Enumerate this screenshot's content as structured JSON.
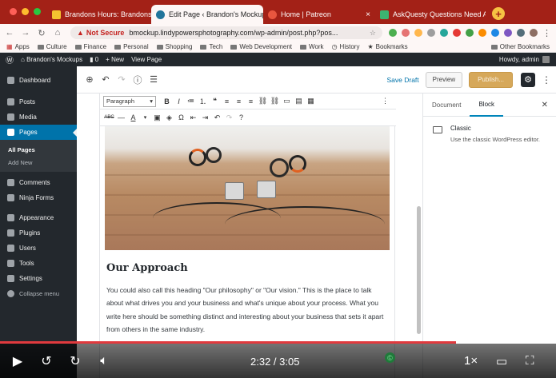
{
  "browser": {
    "tabs": [
      {
        "title": "Brandons Hours: Brandons Ho",
        "active": false,
        "favicon_color": "#f4c430"
      },
      {
        "title": "Edit Page ‹ Brandon's Mockup",
        "active": true,
        "favicon_color": "#21759b"
      },
      {
        "title": "Home | Patreon",
        "active": false,
        "favicon_color": "#e8563f"
      },
      {
        "title": "AskQuesty Questions Need A",
        "active": false,
        "favicon_color": "#3cb371"
      }
    ],
    "not_secure": "Not Secure",
    "url": "bmockup.lindypowersphotography.com/wp-admin/post.php?pos...",
    "bookmarks": [
      "Apps",
      "Culture",
      "Finance",
      "Personal",
      "Shopping",
      "Tech",
      "Web Development",
      "Work",
      "History",
      "Bookmarks"
    ],
    "other_bookmarks": "Other Bookmarks"
  },
  "adminbar": {
    "site_name": "Brandon's Mockups",
    "comments_count": "0",
    "new_label": "New",
    "view_page": "View Page",
    "howdy": "Howdy, admin"
  },
  "sidebar": {
    "items": [
      {
        "label": "Dashboard"
      },
      {
        "label": "Posts"
      },
      {
        "label": "Media"
      },
      {
        "label": "Pages"
      },
      {
        "label": "Comments"
      },
      {
        "label": "Ninja Forms"
      },
      {
        "label": "Appearance"
      },
      {
        "label": "Plugins"
      },
      {
        "label": "Users"
      },
      {
        "label": "Tools"
      },
      {
        "label": "Settings"
      },
      {
        "label": "Collapse menu"
      }
    ],
    "sub": {
      "all_pages": "All Pages",
      "add_new": "Add New"
    }
  },
  "editor": {
    "save_draft": "Save Draft",
    "preview": "Preview",
    "publish": "Publish...",
    "format_select": "Paragraph",
    "heading": "Our Approach",
    "paragraph": "You could also call this heading \"Our philosophy\" or \"Our vision.\" This is the place to talk about what drives you and your business and what's unique about your process. What you write here should be something distinct and interesting about your business that sets it apart from others in the same industry."
  },
  "panel": {
    "tab_document": "Document",
    "tab_block": "Block",
    "block_name": "Classic",
    "block_desc": "Use the classic WordPress editor."
  },
  "video": {
    "time": "2:32 / 3:05",
    "speed": "1×",
    "progress": 0.82
  },
  "colors": {
    "chrome_tabbar": "#a32117",
    "wp_dark": "#23282d",
    "wp_blue": "#0073aa",
    "progress_red": "#e03a3e"
  }
}
